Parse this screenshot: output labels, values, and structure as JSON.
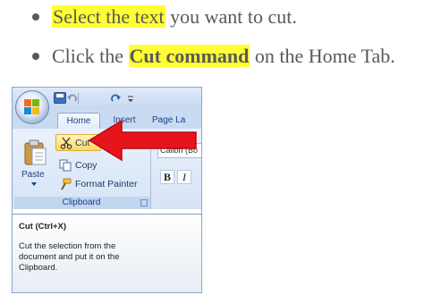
{
  "bullets": [
    {
      "pre": "",
      "highlight": "Select the text",
      "post": " you want to cut."
    },
    {
      "pre": "Click the ",
      "highlight": "Cut command",
      "post": " on the Home Tab."
    }
  ],
  "ribbon": {
    "tabs": [
      "Home",
      "Insert",
      "Page La"
    ],
    "clipboard": {
      "paste_label": "Paste",
      "cut_label": "Cut",
      "copy_label": "Copy",
      "format_painter_label": "Format Painter",
      "group_label": "Clipboard"
    },
    "font_box_value": "Calibri (Bo",
    "bold_label": "B",
    "italic_label": "I"
  },
  "tooltip": {
    "title": "Cut (Ctrl+X)",
    "body_lines": [
      "Cut the selection from the",
      "document and put it on the",
      "Clipboard."
    ]
  },
  "colors": {
    "highlight": "#ffff33",
    "arrow": "#e8141c",
    "bullet_text": "#595959"
  },
  "icons": [
    "office-button-icon",
    "save-icon",
    "undo-icon",
    "redo-icon",
    "paste-icon",
    "scissors-icon",
    "copy-icon",
    "format-painter-icon",
    "dialog-launcher-icon",
    "arrow-icon"
  ]
}
